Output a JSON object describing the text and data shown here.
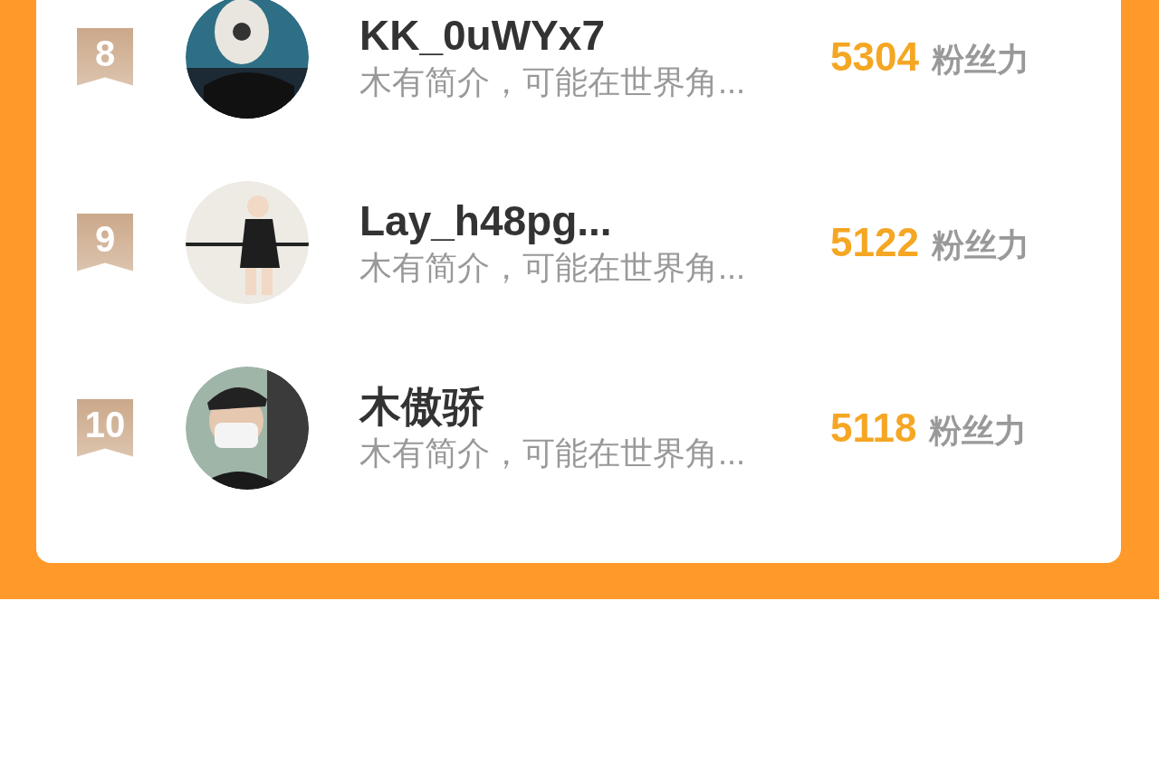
{
  "ranking": [
    {
      "rank": "8",
      "name": "KK_0uWYx7",
      "intro": "木有简介，可能在世界角...",
      "score": "5304",
      "score_unit": "粉丝力"
    },
    {
      "rank": "9",
      "name": "Lay_h48pg...",
      "intro": "木有简介，可能在世界角...",
      "score": "5122",
      "score_unit": "粉丝力"
    },
    {
      "rank": "10",
      "name": "木傲骄",
      "intro": "木有简介，可能在世界角...",
      "score": "5118",
      "score_unit": "粉丝力"
    }
  ]
}
